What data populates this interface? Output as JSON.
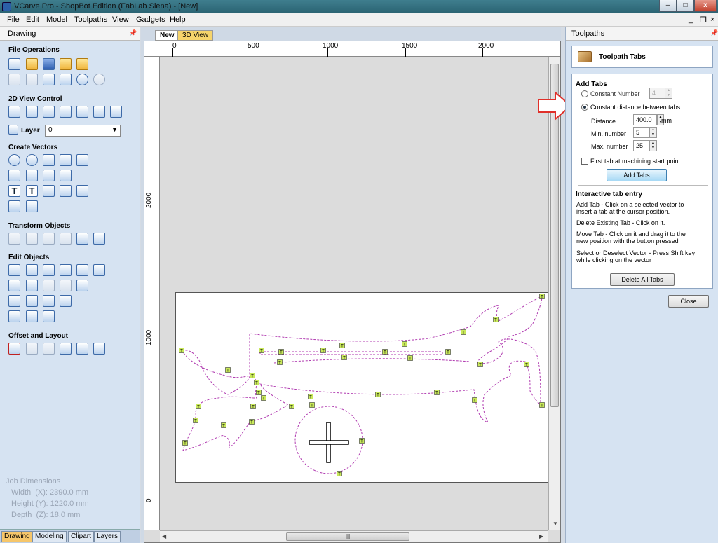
{
  "window": {
    "title": "VCarve Pro - ShopBot Edition (FabLab Siena) - [New]"
  },
  "menu": [
    "File",
    "Edit",
    "Model",
    "Toolpaths",
    "View",
    "Gadgets",
    "Help"
  ],
  "menu_controls": [
    "_",
    "❐",
    "×"
  ],
  "left": {
    "title": "Drawing",
    "sections": {
      "file": "File Operations",
      "view": "2D View Control",
      "create": "Create Vectors",
      "transform": "Transform Objects",
      "edit": "Edit Objects",
      "offset": "Offset and Layout"
    },
    "layer_label": "Layer",
    "layer_value": "0",
    "job_title": "Job Dimensions",
    "job_width": "Width  (X): 2390.0 mm",
    "job_height": "Height (Y): 1220.0 mm",
    "job_depth": "Depth  (Z): 18.0 mm",
    "tabs": [
      "Drawing",
      "Modeling",
      "Clipart",
      "Layers"
    ]
  },
  "doc": {
    "tabs": {
      "new": "New",
      "view3d": "3D View"
    },
    "ruler_h": [
      "0",
      "500",
      "1000",
      "1500",
      "2000"
    ],
    "ruler_v": [
      "2000",
      "1000",
      "0"
    ]
  },
  "right": {
    "title": "Toolpaths",
    "card_title": "Toolpath Tabs",
    "add_tabs": "Add Tabs",
    "constant_number": "Constant Number",
    "constant_number_value": "4",
    "constant_distance": "Constant distance between tabs",
    "distance_label": "Distance",
    "distance_value": "400.0",
    "distance_unit": "mm",
    "min_label": "Min. number",
    "min_value": "5",
    "max_label": "Max. number",
    "max_value": "25",
    "first_tab": "First tab at machining start point",
    "add_tabs_button": "Add Tabs",
    "interactive_title": "Interactive tab entry",
    "help1a": "Add Tab - Click on a selected vector to",
    "help1b": "insert a tab at the cursor position.",
    "help2": "Delete Existing Tab - Click on it.",
    "help3a": "Move Tab - Click on it and drag it to the",
    "help3b": "new position with the button pressed",
    "help4a": "Select or Deselect Vector - Press Shift key",
    "help4b": "while clicking on the vector",
    "delete_all": "Delete All Tabs",
    "close": "Close"
  },
  "colors": {
    "vector": "#b03ab0",
    "tab_fill": "#c8e85a",
    "annotation_arrow": "#e0302a"
  },
  "tab_marker": "T"
}
